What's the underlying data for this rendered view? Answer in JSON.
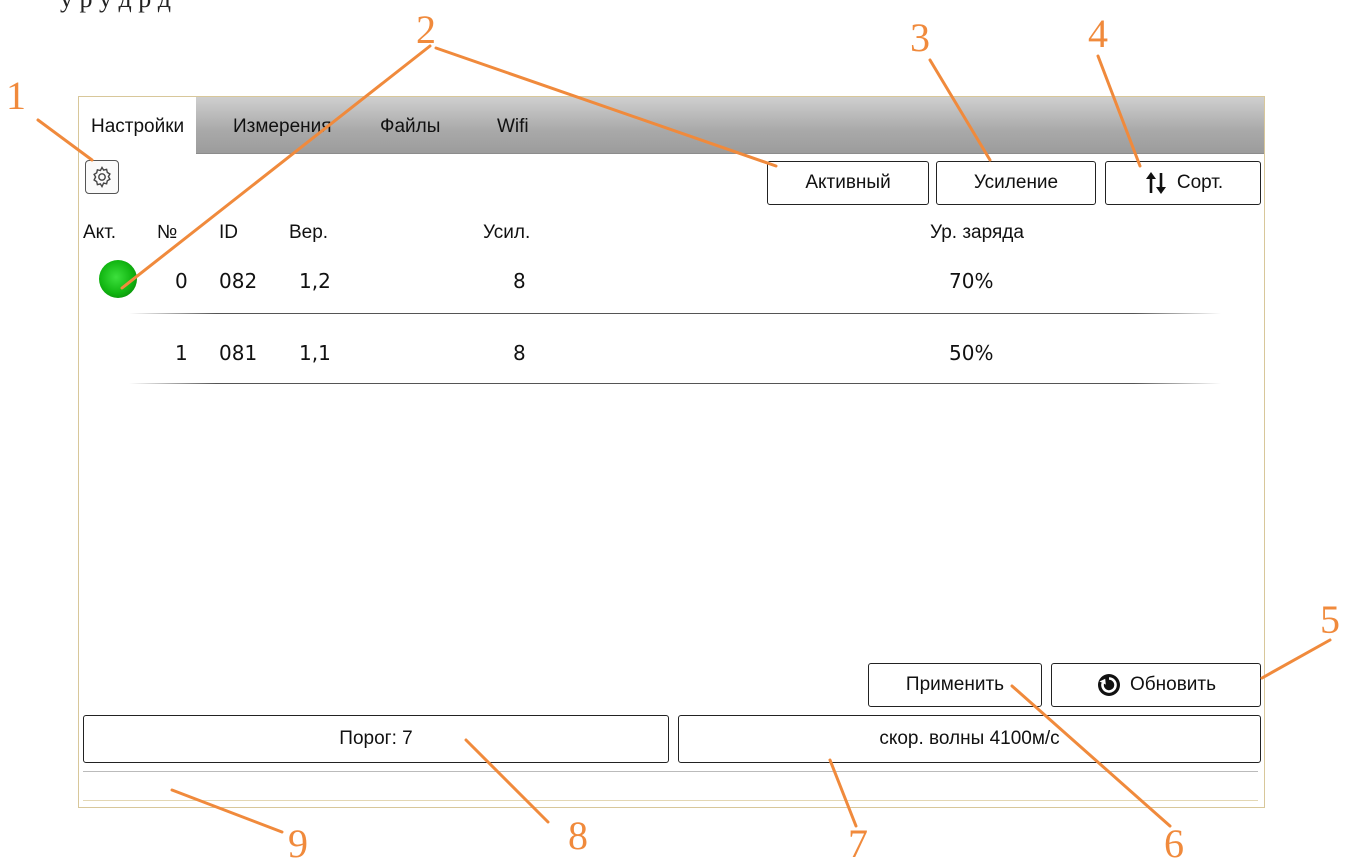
{
  "caption_fragment": "у                                   р                         у     д                   р                                        д",
  "tabs": [
    "Настройки",
    "Измерения",
    "Файлы",
    "Wifi"
  ],
  "toolbar": {
    "settings_icon": "gear-icon",
    "active_label": "Активный",
    "gain_label": "Усиление",
    "sort_label": "Сорт.",
    "sort_icon": "sort-arrows-icon"
  },
  "table": {
    "headers": [
      "Акт.",
      "№",
      "ID",
      "Вер.",
      "Усил.",
      "Ур. заряда"
    ],
    "rows": [
      {
        "active": true,
        "num": "0",
        "id": "082",
        "ver": "1,2",
        "gain": "8",
        "charge": "70%"
      },
      {
        "active": false,
        "num": "1",
        "id": "081",
        "ver": "1,1",
        "gain": "8",
        "charge": "50%"
      }
    ]
  },
  "actions": {
    "apply_label": "Применить",
    "refresh_label": "Обновить",
    "refresh_icon": "refresh-icon"
  },
  "fields": {
    "threshold": "Порог: 7",
    "wave_speed": "скор. волны 4100м/с"
  },
  "callouts": [
    "1",
    "2",
    "3",
    "4",
    "5",
    "6",
    "7",
    "8",
    "9"
  ],
  "colors": {
    "callout": "#f08a3c",
    "led_active": "#22c822",
    "tabbar": "#a9a9a9",
    "frame": "#d8c79a"
  }
}
